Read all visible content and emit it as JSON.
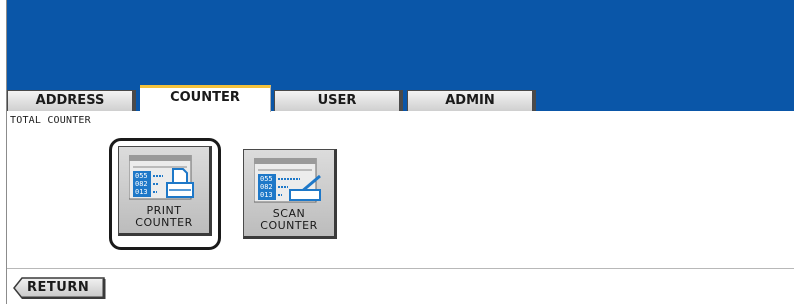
{
  "tabs": [
    {
      "label": "ADDRESS",
      "active": false
    },
    {
      "label": "COUNTER",
      "active": true
    },
    {
      "label": "USER",
      "active": false
    },
    {
      "label": "ADMIN",
      "active": false
    }
  ],
  "section_title": "TOTAL COUNTER",
  "tiles": [
    {
      "line1": "PRINT",
      "line2": "COUNTER",
      "icon": "print-counter-icon",
      "selected": true
    },
    {
      "line1": "SCAN",
      "line2": "COUNTER",
      "icon": "scan-counter-icon",
      "selected": false
    }
  ],
  "icon_text": {
    "row1": "055",
    "row2": "082",
    "row3": "013"
  },
  "return_label": "RETURN",
  "colors": {
    "header_blue": "#0a56a8",
    "active_tab_accent": "#f4c23c",
    "icon_blue": "#1e78c8",
    "tile_gray": "#c8c8c8"
  }
}
